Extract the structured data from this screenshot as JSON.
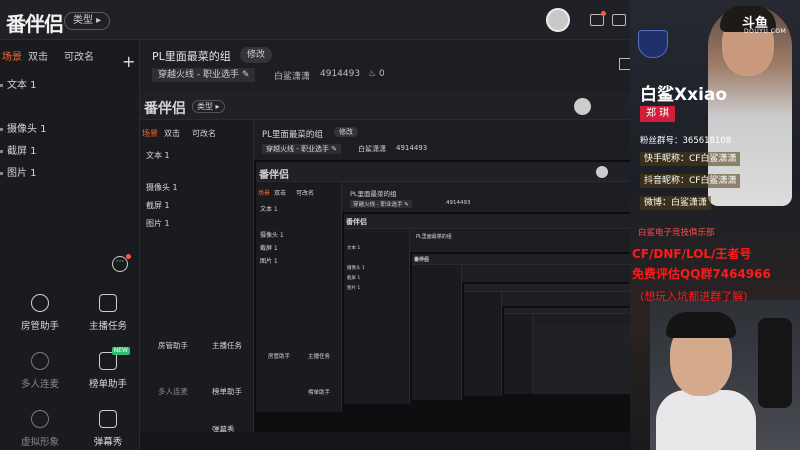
{
  "app": {
    "logo": "番伴侣",
    "type_button": "类型 ▸",
    "tabs": [
      "场景",
      "双击",
      "可改名"
    ],
    "add_label": "+",
    "sources": [
      "文本 1",
      "摄像头 1",
      "截屏 1",
      "图片 1"
    ],
    "more_label": "···",
    "tools": [
      {
        "label": "房管助手",
        "icon": "manager-icon"
      },
      {
        "label": "主播任务",
        "icon": "task-icon"
      },
      {
        "label": "多人连麦",
        "icon": "download-icon"
      },
      {
        "label": "榜单助手",
        "icon": "ranking-icon",
        "badge": "NEW"
      },
      {
        "label": "虚拟形象",
        "icon": "download-icon"
      },
      {
        "label": "弹幕秀",
        "icon": "danmaku-icon"
      }
    ],
    "room_title": "PL里面最菜的组",
    "edit_label": "修改",
    "category": "穿越火线 - 职业选手 ✎",
    "owner": "白鲨潇潇",
    "room_id": "4914493",
    "hot_count": "0",
    "accent": "#ff6a2b"
  },
  "overlay": {
    "platform": "斗鱼",
    "platform_sub": "DOUYU.COM",
    "streamer_name": "白鲨Xxiao",
    "real_name": "郑 琪",
    "fan_group": "粉丝群号：365618108",
    "kuaishou": "快手昵称：CF白鲨潇潇",
    "douyin": "抖音昵称：CF白鲨潇潇",
    "weibo": "微博：白鲨潇潇",
    "club": "白鲨电子竞技俱乐部",
    "ad_line1": "CF/DNF/LOL/王者号",
    "ad_line2": "免费评估QQ群7464966",
    "ad_line3": "(想玩入坑都进群了解)",
    "ad_color": "#ff1a1a"
  }
}
